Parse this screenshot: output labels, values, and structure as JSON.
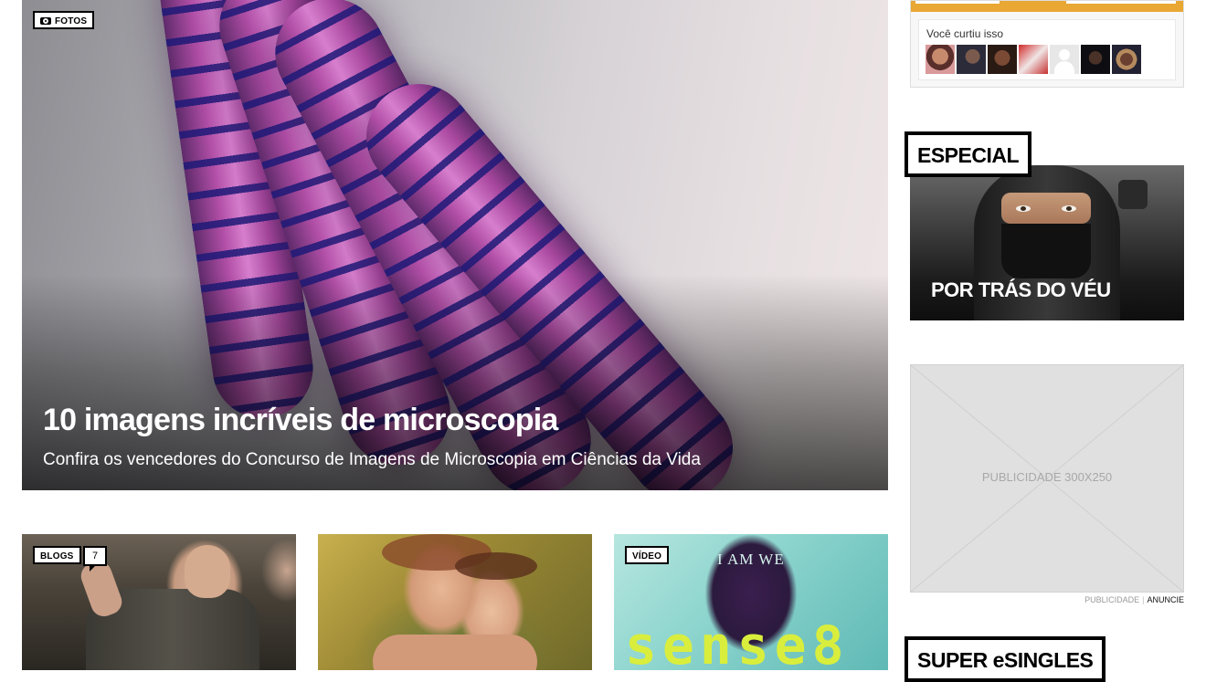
{
  "hero": {
    "tag": "FOTOS",
    "tag_icon": "camera-icon",
    "title": "10 imagens incríveis de microscopia",
    "subtitle": "Confira os vencedores do Concurso de Imagens de Microscopia em Ciências da Vida"
  },
  "cards": [
    {
      "tag": "BLOGS",
      "comments": "7",
      "comment_icon": "speech-bubble-icon"
    },
    {},
    {
      "tag": "VÍDEO",
      "image_text_top": "I AM WE",
      "image_text_logo": "sense8"
    }
  ],
  "sidebar": {
    "facebook": {
      "label": "Você curtiu isso",
      "accent_color": "#e9a733",
      "avatars": [
        "avatar-1",
        "avatar-2",
        "avatar-3",
        "avatar-4",
        "avatar-5",
        "avatar-6",
        "avatar-7"
      ]
    },
    "especial": {
      "heading": "ESPECIAL",
      "caption": "POR TRÁS DO VÉU"
    },
    "ad": {
      "label": "PUBLICIDADE 300X250",
      "footer_left": "PUBLICIDADE",
      "footer_sep": "|",
      "footer_right": "ANUNCIE"
    },
    "super": {
      "heading": "SUPER eSINGLES"
    }
  }
}
